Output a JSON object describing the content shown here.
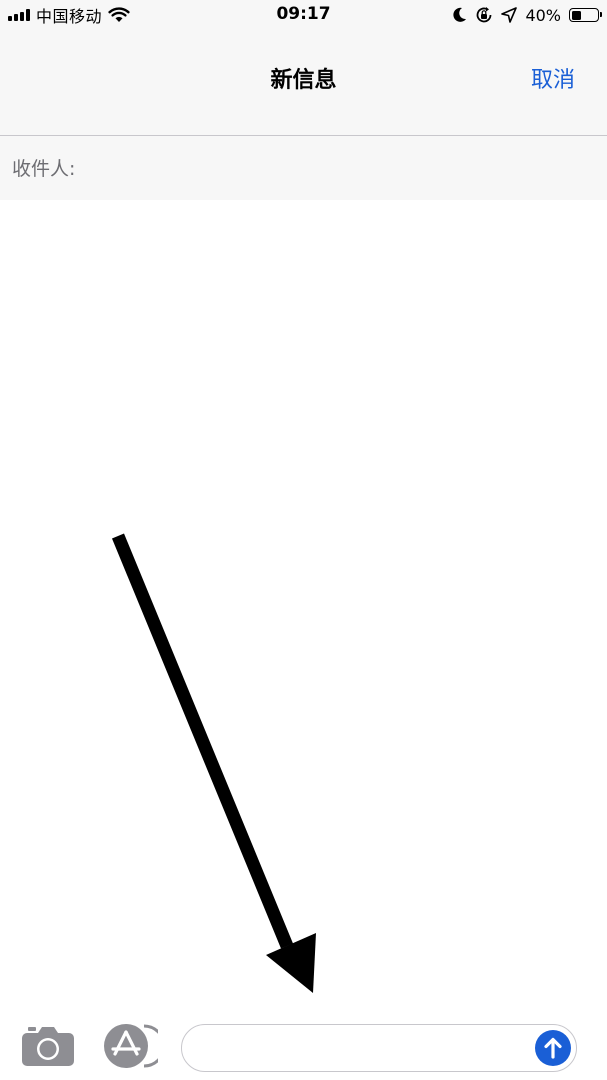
{
  "status_bar": {
    "carrier": "中国移动",
    "time": "09:17",
    "battery_percent_label": "40%",
    "battery_level": 0.4,
    "icons": [
      "signal-icon",
      "wifi-icon",
      "moon-icon",
      "orientation-lock-icon",
      "location-icon",
      "battery-icon"
    ]
  },
  "nav": {
    "title": "新信息",
    "cancel_label": "取消"
  },
  "recipient": {
    "label": "收件人:",
    "value": ""
  },
  "composer": {
    "message_value": "",
    "icons": [
      "camera-icon",
      "app-store-icon",
      "send-arrow-icon"
    ]
  },
  "annotation": {
    "icon": "pointing-arrow-icon"
  },
  "colors": {
    "accent": "#1a5fd6",
    "bar_background": "#f7f7f7",
    "separator": "#c8c7cc",
    "icon_gray": "#8e8e93",
    "label_gray": "#6d6d72"
  }
}
